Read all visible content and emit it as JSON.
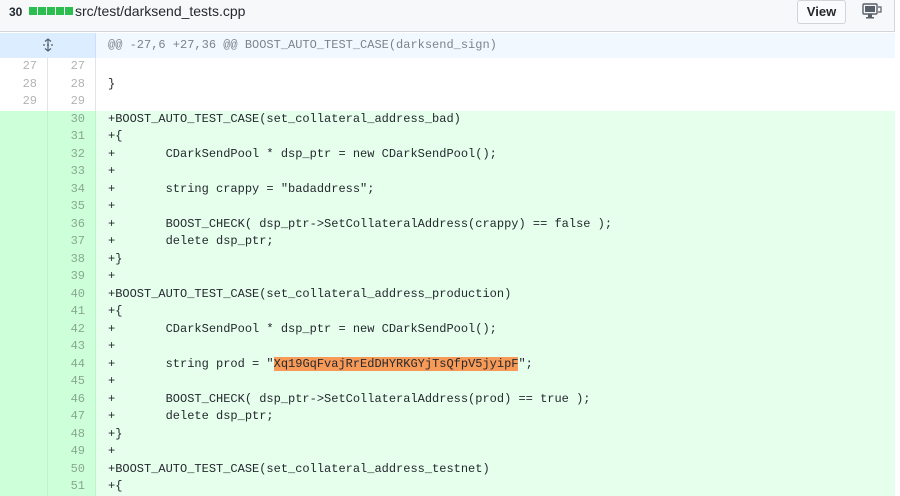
{
  "file": {
    "changes": "30",
    "diffstat_color": "#2cbe4e",
    "diffstat_blocks": 5,
    "path": "src/test/darksend_tests.cpp",
    "view_label": "View",
    "display_icon": "display-icon"
  },
  "hunk": {
    "icon": "unfold-icon",
    "header": "@@ -27,6 +27,36 @@ BOOST_AUTO_TEST_CASE(darksend_sign)"
  },
  "lines": [
    {
      "type": "ctx",
      "old": "27",
      "new": "27",
      "code": ""
    },
    {
      "type": "ctx",
      "old": "28",
      "new": "28",
      "code": "}"
    },
    {
      "type": "ctx",
      "old": "29",
      "new": "29",
      "code": ""
    },
    {
      "type": "add",
      "old": "",
      "new": "30",
      "code": "+BOOST_AUTO_TEST_CASE(set_collateral_address_bad)"
    },
    {
      "type": "add",
      "old": "",
      "new": "31",
      "code": "+{"
    },
    {
      "type": "add",
      "old": "",
      "new": "32",
      "code": "+       CDarkSendPool * dsp_ptr = new CDarkSendPool();"
    },
    {
      "type": "add",
      "old": "",
      "new": "33",
      "code": "+"
    },
    {
      "type": "add",
      "old": "",
      "new": "34",
      "code": "+       string crappy = \"badaddress\";"
    },
    {
      "type": "add",
      "old": "",
      "new": "35",
      "code": "+"
    },
    {
      "type": "add",
      "old": "",
      "new": "36",
      "code": "+       BOOST_CHECK( dsp_ptr->SetCollateralAddress(crappy) == false );"
    },
    {
      "type": "add",
      "old": "",
      "new": "37",
      "code": "+       delete dsp_ptr;"
    },
    {
      "type": "add",
      "old": "",
      "new": "38",
      "code": "+}"
    },
    {
      "type": "add",
      "old": "",
      "new": "39",
      "code": "+"
    },
    {
      "type": "add",
      "old": "",
      "new": "40",
      "code": "+BOOST_AUTO_TEST_CASE(set_collateral_address_production)"
    },
    {
      "type": "add",
      "old": "",
      "new": "41",
      "code": "+{"
    },
    {
      "type": "add",
      "old": "",
      "new": "42",
      "code": "+       CDarkSendPool * dsp_ptr = new CDarkSendPool();"
    },
    {
      "type": "add",
      "old": "",
      "new": "43",
      "code": "+"
    },
    {
      "type": "add",
      "old": "",
      "new": "44",
      "code_pre": "+       string prod = \"",
      "code_hl": "Xq19GqFvajRrEdDHYRKGYjTsQfpV5jyipF",
      "code_post": "\";"
    },
    {
      "type": "add",
      "old": "",
      "new": "45",
      "code": "+"
    },
    {
      "type": "add",
      "old": "",
      "new": "46",
      "code": "+       BOOST_CHECK( dsp_ptr->SetCollateralAddress(prod) == true );"
    },
    {
      "type": "add",
      "old": "",
      "new": "47",
      "code": "+       delete dsp_ptr;"
    },
    {
      "type": "add",
      "old": "",
      "new": "48",
      "code": "+}"
    },
    {
      "type": "add",
      "old": "",
      "new": "49",
      "code": "+"
    },
    {
      "type": "add",
      "old": "",
      "new": "50",
      "code": "+BOOST_AUTO_TEST_CASE(set_collateral_address_testnet)"
    },
    {
      "type": "add",
      "old": "",
      "new": "51",
      "code": "+{"
    }
  ]
}
